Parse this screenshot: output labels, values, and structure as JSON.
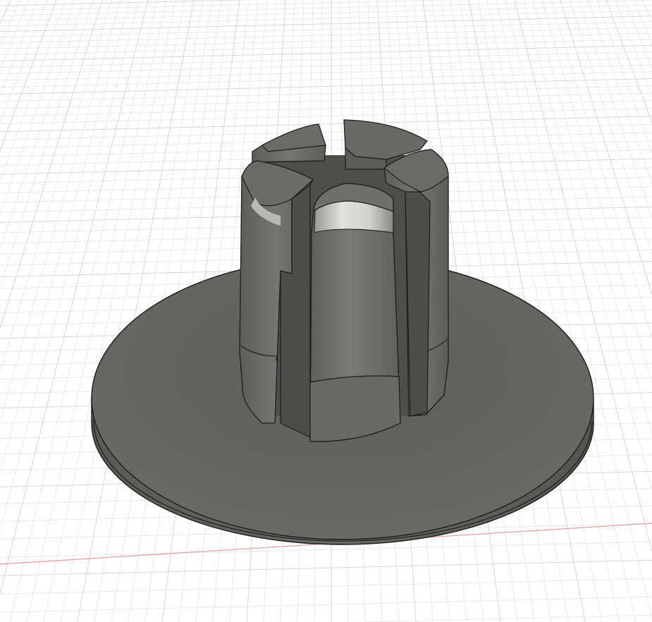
{
  "viewport": {
    "background_color": "#ffffff",
    "grid": {
      "visible": true,
      "minor_color": "#e6e8ec",
      "major_color": "#d3d6dc"
    },
    "x_axis_color": "#e79a9a"
  },
  "model": {
    "edge_color": "#1c1c1c",
    "body_color": "#6d6c66",
    "base_top_color": "#64635d",
    "base_side_color": "#5b5a55",
    "highlight_color": "#d9d8d3",
    "prong_count": 5
  }
}
